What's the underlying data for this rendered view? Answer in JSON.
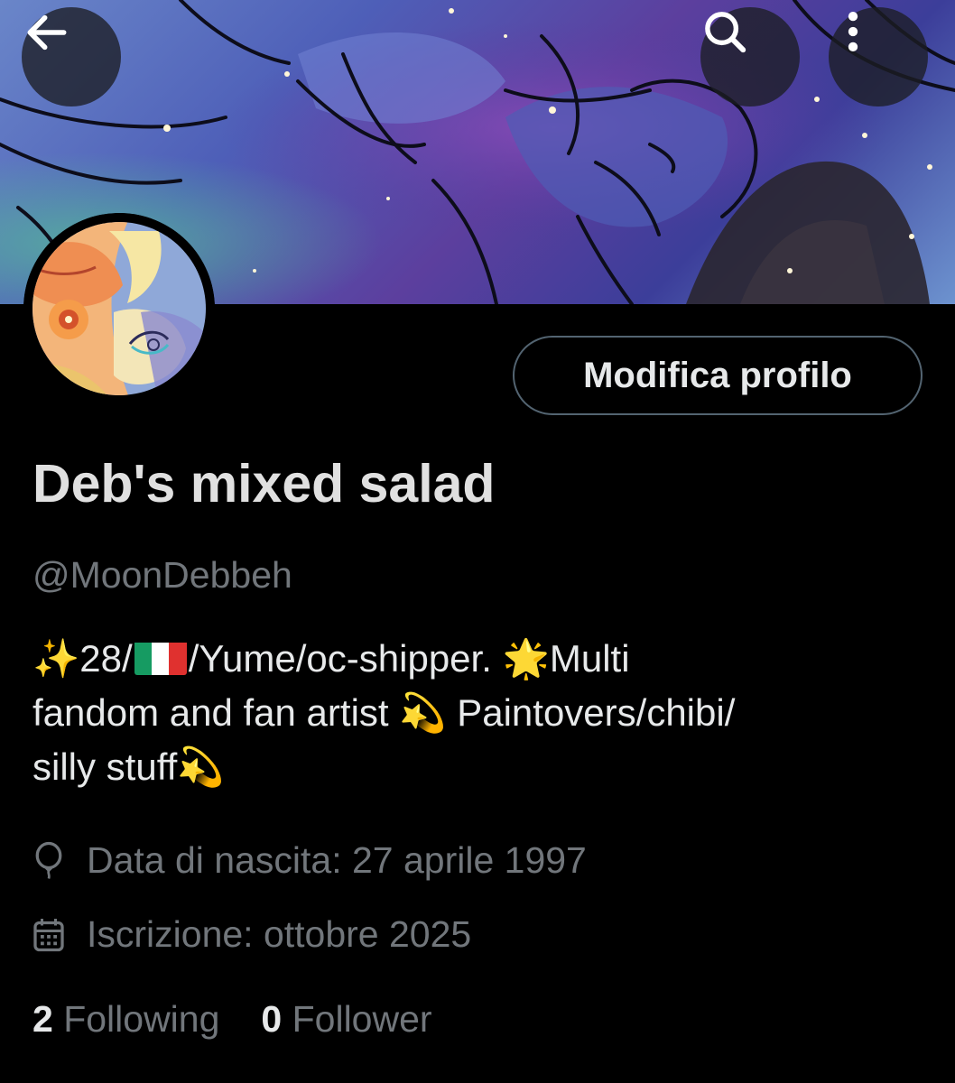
{
  "header": {
    "back_icon": "arrow-left-icon",
    "search_icon": "search-icon",
    "more_icon": "more-vertical-icon"
  },
  "profile": {
    "edit_label": "Modifica profilo",
    "display_name": "Deb's mixed salad",
    "handle": "@MoonDebbeh",
    "bio": {
      "line1_a": "✨",
      "line1_b": "28/",
      "line1_flag": "🇮🇹",
      "line1_c": "/Yume/oc-shipper. ",
      "line1_d": "🌟",
      "line1_e": "Multi",
      "line2_a": "fandom and fan artist  ",
      "line2_b": "💫",
      "line2_c": " Paintovers/chibi/",
      "line3_a": "silly stuff",
      "line3_b": "💫"
    },
    "birth_date": "Data di nascita: 27 aprile 1997",
    "joined": "Iscrizione: ottobre 2025",
    "birth_icon": "balloon-icon",
    "joined_icon": "calendar-icon"
  },
  "stats": {
    "following_count": "2",
    "following_label": " Following",
    "follower_count": "0",
    "follower_label": " Follower"
  },
  "colors": {
    "background": "#000000",
    "primary_text": "#e7e9ea",
    "secondary_text": "#71767b",
    "button_border": "#536471"
  }
}
